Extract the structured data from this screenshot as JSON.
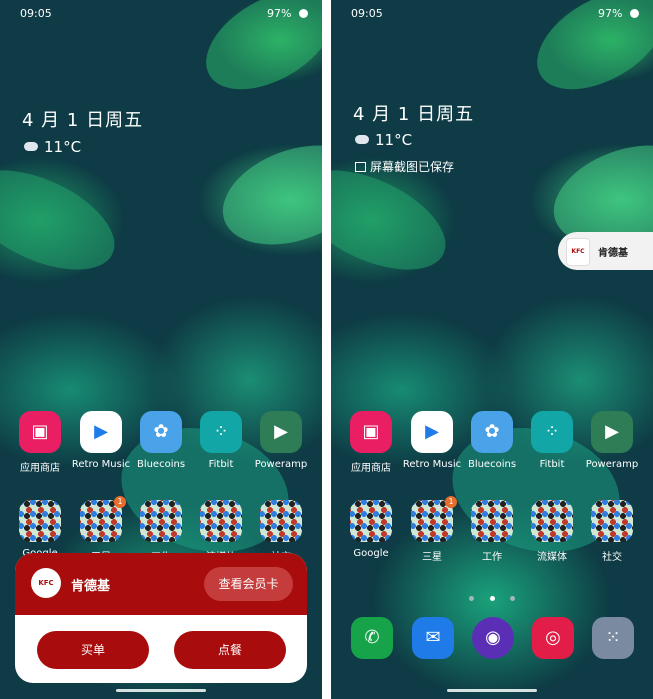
{
  "left": {
    "status": {
      "time": "09:05",
      "battery": "97%"
    },
    "date": "4 月 1 日周五",
    "temp": "11°C",
    "apps": [
      {
        "label": "应用商店",
        "color": "#e91e63",
        "icon": "shopping-bag-icon"
      },
      {
        "label": "Retro Music",
        "color": "#ffffff",
        "icon": "play-icon"
      },
      {
        "label": "Bluecoins",
        "color": "#4aa3e8",
        "icon": "flower-icon"
      },
      {
        "label": "Fitbit",
        "color": "#12a6a6",
        "icon": "dots-grid-icon"
      },
      {
        "label": "Poweramp",
        "color": "#2e7d56",
        "icon": "play-icon"
      }
    ],
    "folders": [
      {
        "label": "Google",
        "badge": ""
      },
      {
        "label": "三星",
        "badge": "1"
      },
      {
        "label": "工作",
        "badge": ""
      },
      {
        "label": "流媒体",
        "badge": ""
      },
      {
        "label": "社交",
        "badge": ""
      }
    ],
    "kfc": {
      "name": "肯德基",
      "logo": "KFC",
      "member": "查看会员卡",
      "order": "买单",
      "meal": "点餐"
    }
  },
  "right": {
    "status": {
      "time": "09:05",
      "battery": "97%"
    },
    "date": "4 月 1 日周五",
    "temp": "11°C",
    "notice": "屏幕截图已保存",
    "float": {
      "name": "肯德基",
      "logo": "KFC"
    },
    "apps": [
      {
        "label": "应用商店",
        "color": "#e91e63",
        "icon": "shopping-bag-icon"
      },
      {
        "label": "Retro Music",
        "color": "#ffffff",
        "icon": "play-icon"
      },
      {
        "label": "Bluecoins",
        "color": "#4aa3e8",
        "icon": "flower-icon"
      },
      {
        "label": "Fitbit",
        "color": "#12a6a6",
        "icon": "dots-grid-icon"
      },
      {
        "label": "Poweramp",
        "color": "#2e7d56",
        "icon": "play-icon"
      }
    ],
    "folders": [
      {
        "label": "Google",
        "badge": ""
      },
      {
        "label": "三星",
        "badge": "1"
      },
      {
        "label": "工作",
        "badge": ""
      },
      {
        "label": "流媒体",
        "badge": ""
      },
      {
        "label": "社交",
        "badge": ""
      }
    ],
    "dock": [
      {
        "name": "phone-icon",
        "color": "#16a34a"
      },
      {
        "name": "messages-icon",
        "color": "#1e7be8"
      },
      {
        "name": "browser-icon",
        "color": "#5b2fb5"
      },
      {
        "name": "camera-icon",
        "color": "#e11d48"
      },
      {
        "name": "app-drawer-icon",
        "color": "#7a8aa0"
      }
    ]
  }
}
